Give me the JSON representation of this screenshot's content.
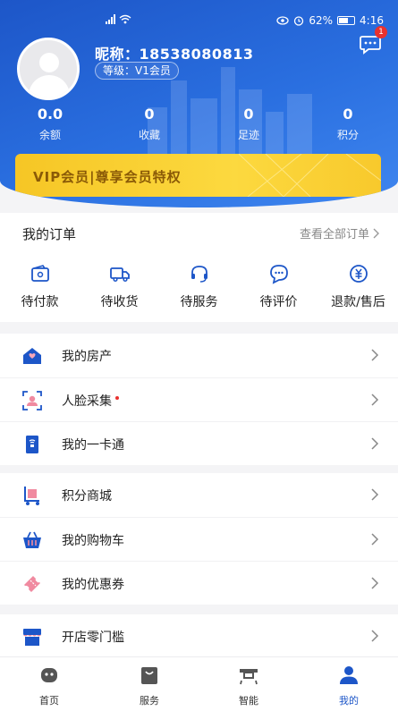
{
  "status_bar": {
    "battery": "62%",
    "time": "4:16",
    "battery_level": 0.62
  },
  "profile": {
    "nickname": "昵称：18538080813",
    "level": "等级：V1会员",
    "message_badge": "1"
  },
  "stats": [
    {
      "value": "0.0",
      "label": "余额"
    },
    {
      "value": "0",
      "label": "收藏"
    },
    {
      "value": "0",
      "label": "足迹"
    },
    {
      "value": "0",
      "label": "积分"
    }
  ],
  "vip_banner": "VIP会员|尊享会员特权",
  "orders": {
    "title": "我的订单",
    "view_all": "查看全部订单",
    "items": [
      {
        "label": "待付款",
        "icon": "wallet-icon"
      },
      {
        "label": "待收货",
        "icon": "truck-icon"
      },
      {
        "label": "待服务",
        "icon": "headset-icon"
      },
      {
        "label": "待评价",
        "icon": "chat-bubble-icon"
      },
      {
        "label": "退款/售后",
        "icon": "refund-icon"
      }
    ]
  },
  "menu_group_1": [
    {
      "label": "我的房产",
      "icon": "house-icon"
    },
    {
      "label": "人脸采集",
      "icon": "face-scan-icon"
    },
    {
      "label": "我的一卡通",
      "icon": "card-icon"
    }
  ],
  "menu_group_2": [
    {
      "label": "积分商城",
      "icon": "cart-trolley-icon"
    },
    {
      "label": "我的购物车",
      "icon": "basket-icon"
    },
    {
      "label": "我的优惠券",
      "icon": "coupon-icon"
    }
  ],
  "menu_group_3": [
    {
      "label": "开店零门槛",
      "icon": "shop-icon"
    }
  ],
  "tabbar": [
    {
      "label": "首页",
      "icon": "home-robot-icon"
    },
    {
      "label": "服务",
      "icon": "bag-icon"
    },
    {
      "label": "智能",
      "icon": "smart-device-icon"
    },
    {
      "label": "我的",
      "icon": "person-icon",
      "active": true
    }
  ],
  "colors": {
    "primary_blue": "#1d56c8",
    "vip_gold": "#f8c92c",
    "vip_text": "#8a5a07",
    "badge_red": "#e8312f"
  }
}
